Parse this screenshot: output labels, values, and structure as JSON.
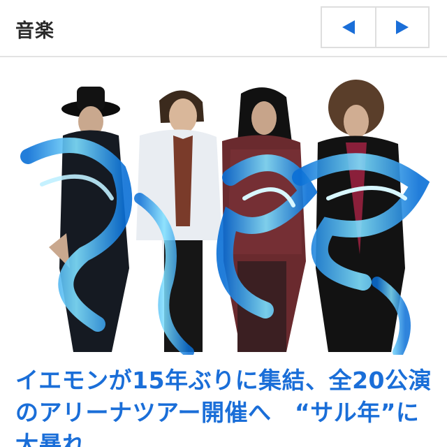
{
  "header": {
    "title": "音楽",
    "prev_icon": "triangle-left-icon",
    "next_icon": "triangle-right-icon",
    "accent_color": "#1a6ed8"
  },
  "article": {
    "image_description_icon": "band-photo",
    "headline": "イエモンが15年ぶりに集結、全20公演のアリーナツアー開催へ　“サル年”に大暴れ"
  }
}
